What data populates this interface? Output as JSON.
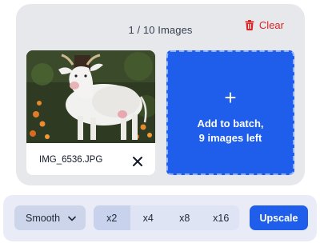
{
  "batch": {
    "counter": "1 / 10 Images",
    "clear_label": "Clear"
  },
  "images": [
    {
      "filename": "IMG_6536.JPG"
    }
  ],
  "add_tile": {
    "line1": "Add to batch,",
    "line2": "9 images left",
    "icon": "plus-icon"
  },
  "toolbar": {
    "mode_selected": "Smooth",
    "scales": [
      "x2",
      "x4",
      "x8",
      "x16"
    ],
    "selected_scale": "x2",
    "upscale_label": "Upscale"
  },
  "colors": {
    "accent": "#1f5eea",
    "danger": "#dc2626",
    "panel": "#e7e8ec",
    "toolbar": "#e9ecf7"
  }
}
